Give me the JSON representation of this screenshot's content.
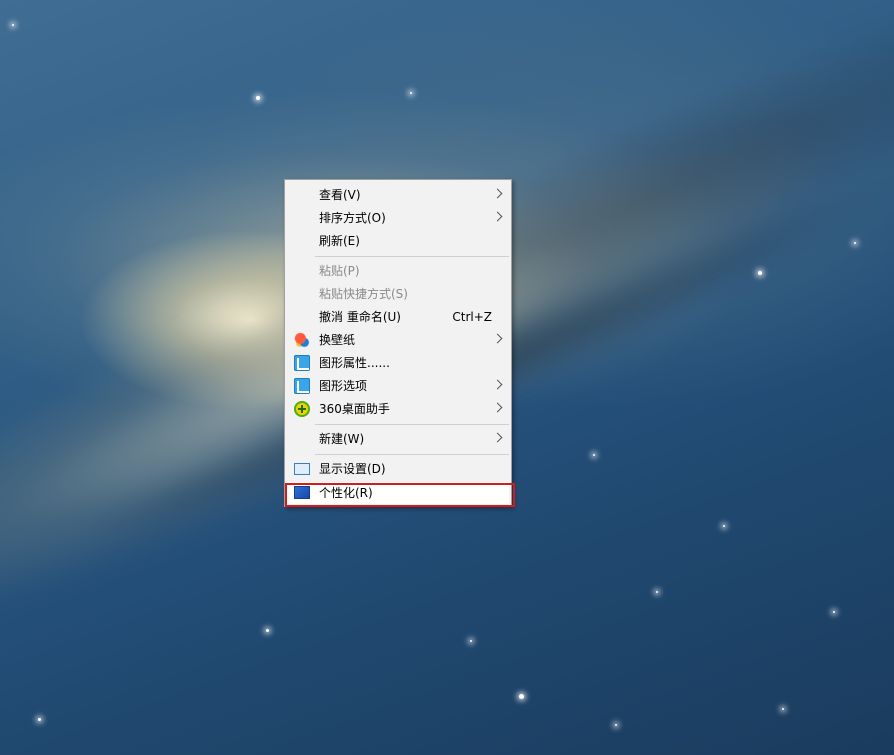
{
  "context_menu": {
    "items": [
      {
        "label": "查看(V)",
        "has_submenu": true,
        "enabled": true
      },
      {
        "label": "排序方式(O)",
        "has_submenu": true,
        "enabled": true
      },
      {
        "label": "刷新(E)",
        "has_submenu": false,
        "enabled": true
      },
      {
        "label": "粘贴(P)",
        "has_submenu": false,
        "enabled": false
      },
      {
        "label": "粘贴快捷方式(S)",
        "has_submenu": false,
        "enabled": false
      },
      {
        "label": "撤消 重命名(U)",
        "shortcut": "Ctrl+Z",
        "has_submenu": false,
        "enabled": true
      },
      {
        "label": "换壁纸",
        "icon": "wallpaper-icon",
        "has_submenu": true,
        "enabled": true
      },
      {
        "label": "图形属性......",
        "icon": "graphics-icon",
        "has_submenu": false,
        "enabled": true
      },
      {
        "label": "图形选项",
        "icon": "graphics-options-icon",
        "has_submenu": true,
        "enabled": true
      },
      {
        "label": "360桌面助手",
        "icon": "desktop-assistant-icon",
        "has_submenu": true,
        "enabled": true
      },
      {
        "label": "新建(W)",
        "has_submenu": true,
        "enabled": true
      },
      {
        "label": "显示设置(D)",
        "icon": "display-icon",
        "has_submenu": false,
        "enabled": true
      },
      {
        "label": "个性化(R)",
        "icon": "personalize-icon",
        "has_submenu": false,
        "enabled": true,
        "highlighted": true
      }
    ]
  },
  "colors": {
    "menu_background": "#f2f2f2",
    "highlight_border": "#d61a1a",
    "disabled_text": "#8a8a8a"
  }
}
